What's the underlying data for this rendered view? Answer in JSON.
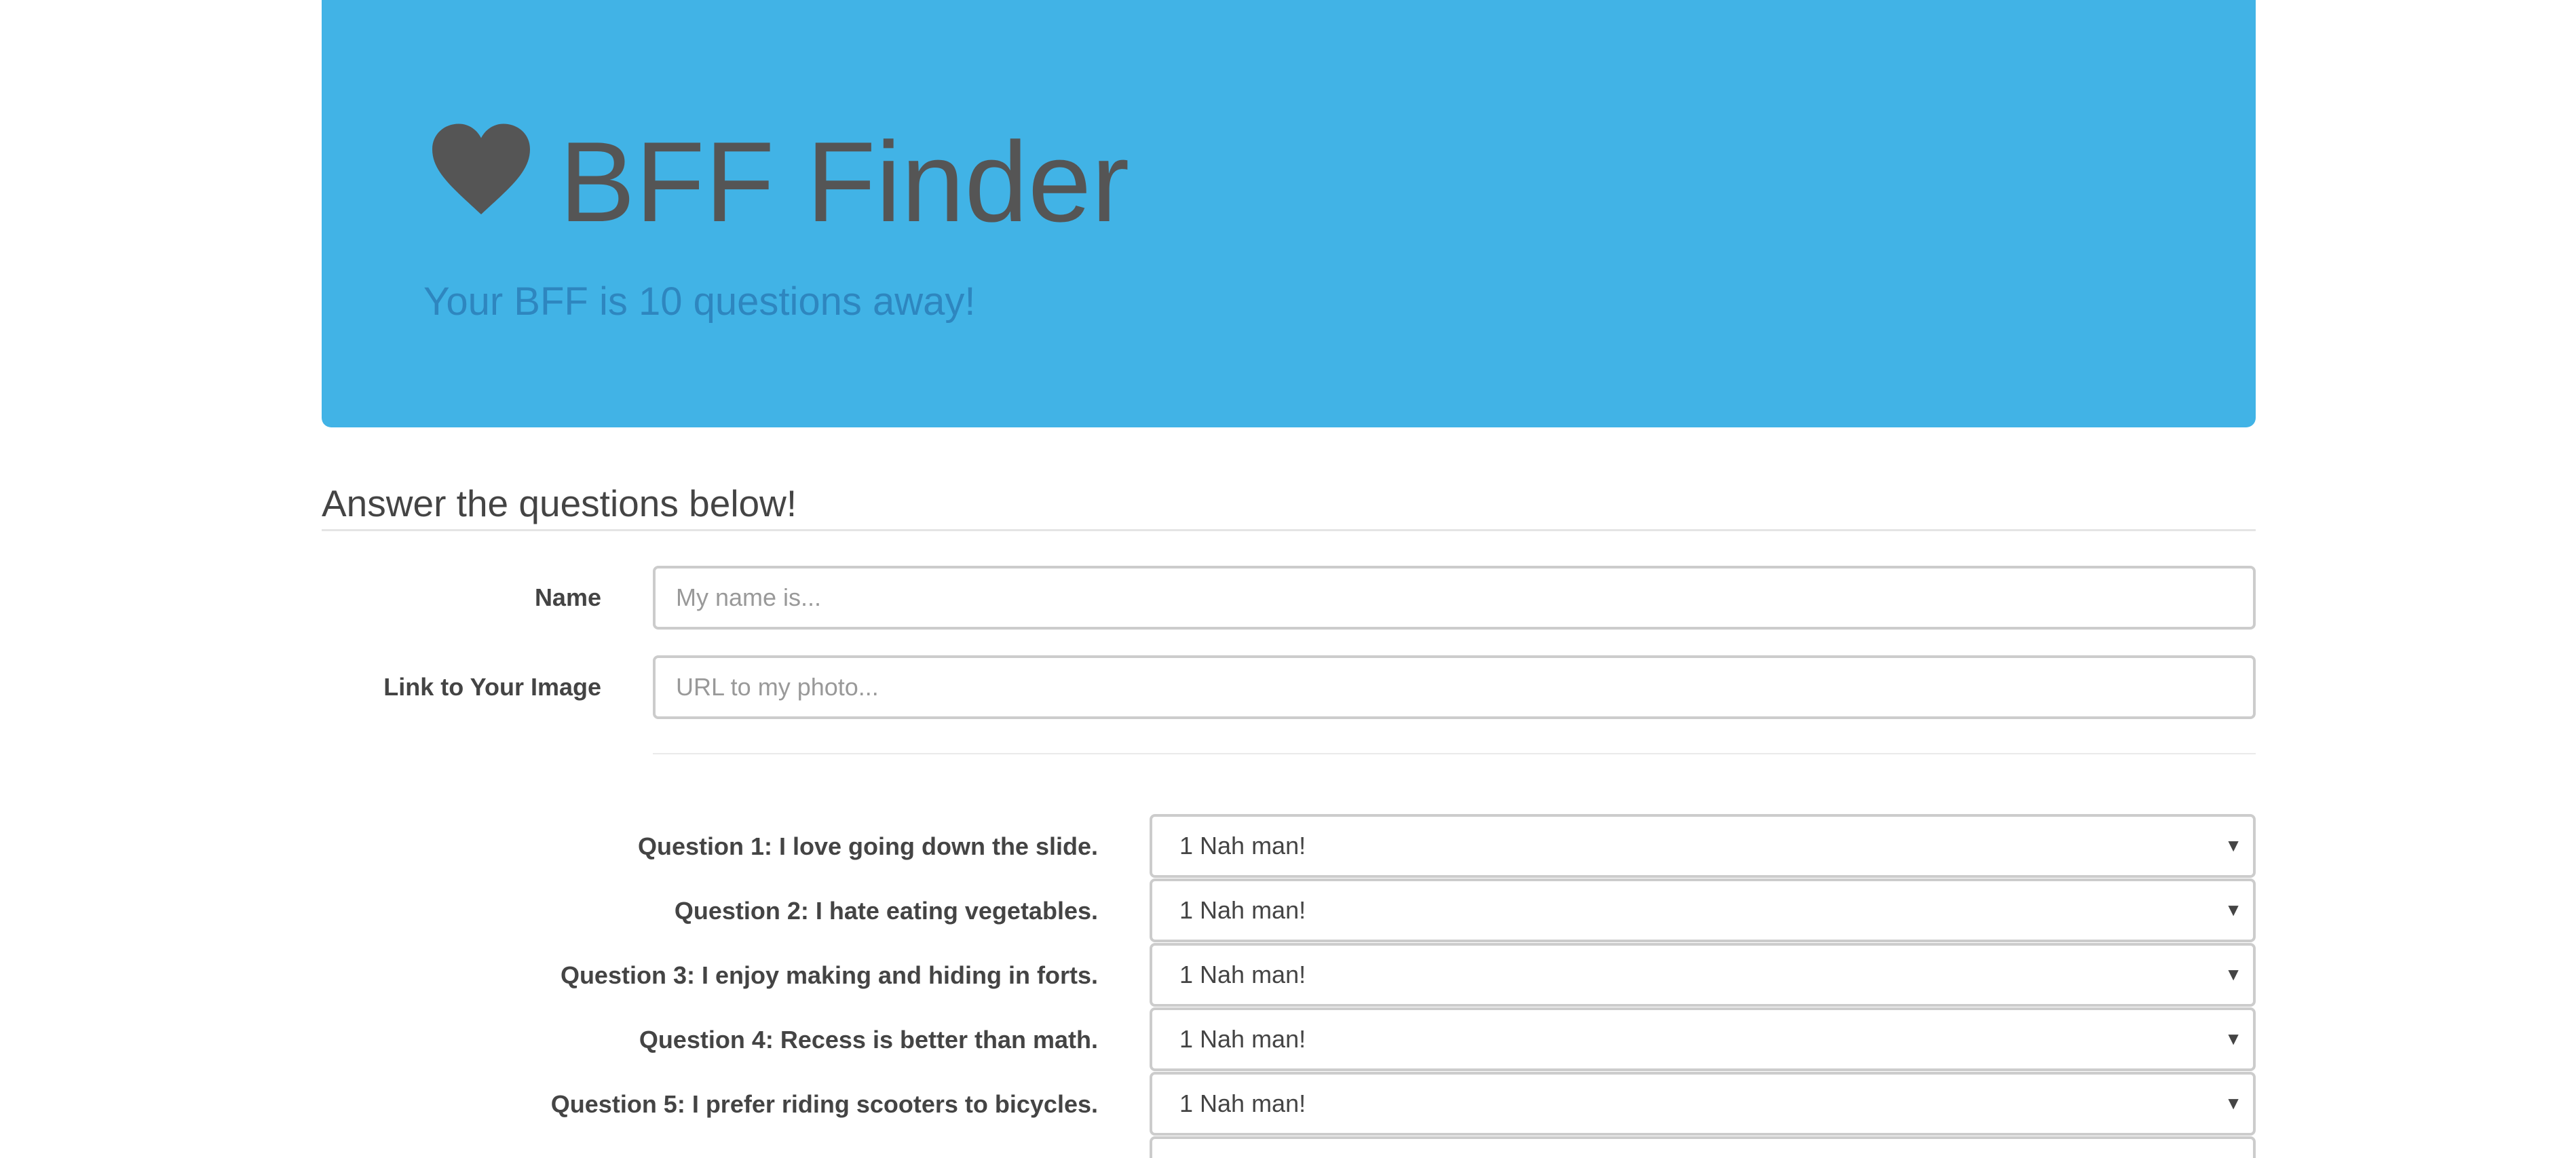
{
  "header": {
    "icon": "heart-icon",
    "title": "BFF Finder",
    "subtitle": "Your BFF is 10 questions away!",
    "bg_color": "#41b3e6"
  },
  "form": {
    "section_title": "Answer the questions below!",
    "name_label": "Name",
    "name_placeholder": "My name is...",
    "image_label": "Link to Your Image",
    "image_placeholder": "URL to my photo...",
    "questions": [
      {
        "label": "Question 1: I love going down the slide.",
        "value": "1 Nah man!"
      },
      {
        "label": "Question 2: I hate eating vegetables.",
        "value": "1 Nah man!"
      },
      {
        "label": "Question 3: I enjoy making and hiding in forts.",
        "value": "1 Nah man!"
      },
      {
        "label": "Question 4: Recess is better than math.",
        "value": "1 Nah man!"
      },
      {
        "label": "Question 5: I prefer riding scooters to bicycles.",
        "value": "1 Nah man!"
      }
    ]
  }
}
